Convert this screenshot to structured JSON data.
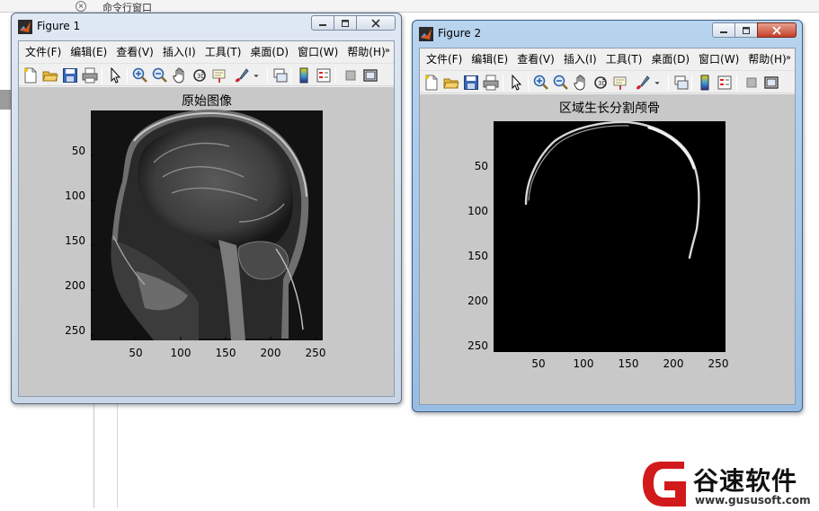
{
  "background": {
    "command_window_title": "命令行窗口"
  },
  "menu_labels": [
    "文件(F)",
    "编辑(E)",
    "查看(V)",
    "插入(I)",
    "工具(T)",
    "桌面(D)",
    "窗口(W)",
    "帮助(H)"
  ],
  "toolbar_icons": [
    "new-file-icon",
    "open-folder-icon",
    "save-icon",
    "print-icon",
    "pointer-icon",
    "zoom-in-icon",
    "zoom-out-icon",
    "pan-hand-icon",
    "rotate-3d-icon",
    "data-cursor-icon",
    "brush-icon",
    "dropdown-arrow-icon",
    "link-plot-icon",
    "colorbar-icon",
    "legend-icon",
    "hide-plot-tools-icon",
    "show-plot-tools-icon"
  ],
  "figure1": {
    "title": "Figure 1",
    "axes_title": "原始图像",
    "x_ticks": [
      "50",
      "100",
      "150",
      "200",
      "250"
    ],
    "y_ticks": [
      "50",
      "100",
      "150",
      "200",
      "250"
    ]
  },
  "figure2": {
    "title": "Figure 2",
    "axes_title": "区域生长分割颅骨",
    "x_ticks": [
      "50",
      "100",
      "150",
      "200",
      "250"
    ],
    "y_ticks": [
      "50",
      "100",
      "150",
      "200",
      "250"
    ]
  },
  "watermark": {
    "logo_letter": "G",
    "brand": "谷速软件",
    "url": "www.gususoft.com"
  },
  "colors": {
    "matlab_orange": "#d9581c",
    "plot_bg": "#c8c8c8",
    "close_red": "#c2412b",
    "logo_red": "#d2191c"
  }
}
